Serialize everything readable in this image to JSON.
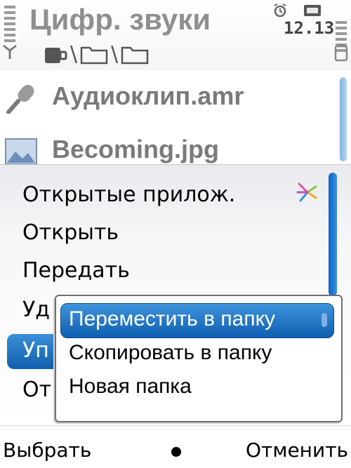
{
  "statusbar": {
    "title": "Цифр. звуки",
    "time": "12.13"
  },
  "path": [
    "memory-card-icon",
    "folder-icon",
    "folder-icon"
  ],
  "file_list": [
    {
      "name": "Аудиоклип.amr",
      "icon": "microphone-icon"
    },
    {
      "name": "Becoming.jpg",
      "icon": "image-icon"
    }
  ],
  "options_menu": {
    "items": [
      {
        "label": "Открытые прилож."
      },
      {
        "label": "Открыть"
      },
      {
        "label": "Передать"
      },
      {
        "label": "Уд"
      },
      {
        "label": "Уп"
      },
      {
        "label": "От"
      }
    ],
    "highlighted_index": 4
  },
  "submenu": {
    "items": [
      {
        "label": "Переместить в папку"
      },
      {
        "label": "Скопировать в папку"
      },
      {
        "label": "Новая папка"
      }
    ],
    "selected_index": 0
  },
  "softkeys": {
    "left": "Выбрать",
    "right": "Отменить"
  },
  "colors": {
    "highlight": "#1f74c6",
    "title_text": "#8f8f8f",
    "scrollbar": "#0b64c4"
  }
}
